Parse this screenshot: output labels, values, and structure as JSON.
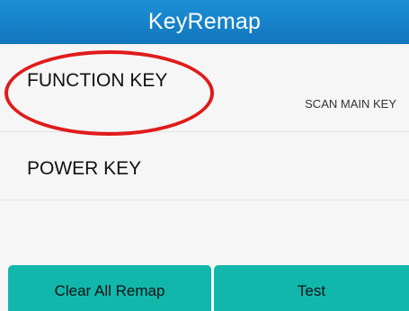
{
  "app_bar": {
    "title": "KeyRemap"
  },
  "key_list": {
    "items": [
      {
        "label": "FUNCTION KEY",
        "mapped_to": "SCAN MAIN KEY"
      },
      {
        "label": "POWER KEY",
        "mapped_to": ""
      }
    ]
  },
  "actions": {
    "clear_label": "Clear All Remap",
    "test_label": "Test"
  },
  "colors": {
    "app_bar": "#1682cc",
    "button": "#12b7ac",
    "annotation": "#e01b1b"
  }
}
